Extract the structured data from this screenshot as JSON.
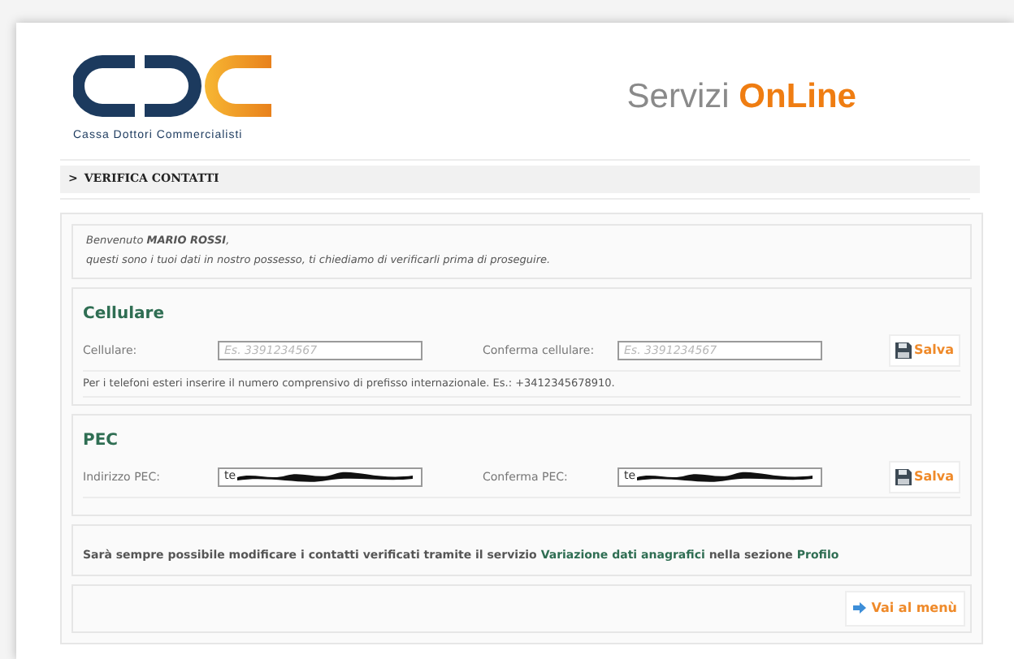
{
  "header": {
    "logo_caption": "Cassa Dottori Commercialisti",
    "title_plain": "Servizi",
    "title_accent": "OnLine"
  },
  "breadcrumb": {
    "arrow": ">",
    "label": "VERIFICA CONTATTI"
  },
  "welcome": {
    "greeting": "Benvenuto **MARIO ROSSI**,",
    "message": "questi sono i tuoi dati in nostro possesso, ti chiediamo di verificarli prima di proseguire."
  },
  "sections": [
    {
      "title": "Cellulare",
      "fields": [
        {
          "label": "Cellulare:",
          "placeholder": "Es. 3391234567",
          "redacted": false
        },
        {
          "label": "Conferma cellulare:",
          "placeholder": "Es. 3391234567",
          "redacted": false
        }
      ],
      "save": "Salva",
      "note": "Per i telefoni esteri inserire il numero comprensivo di prefisso internazionale. Es.: +3412345678910."
    },
    {
      "title": "PEC",
      "fields": [
        {
          "label": "Indirizzo PEC:",
          "value": "te",
          "redacted": true
        },
        {
          "label": "Conferma PEC:",
          "value": "te",
          "redacted": true
        }
      ],
      "save": "Salva"
    }
  ],
  "info": {
    "before": "Sarà sempre possibile modificare i contatti verificati tramite il servizio",
    "link1": "Variazione dati anagrafici",
    "middle": "nella sezione",
    "link2": "Profilo"
  },
  "menu_button": "Vai al menù"
}
